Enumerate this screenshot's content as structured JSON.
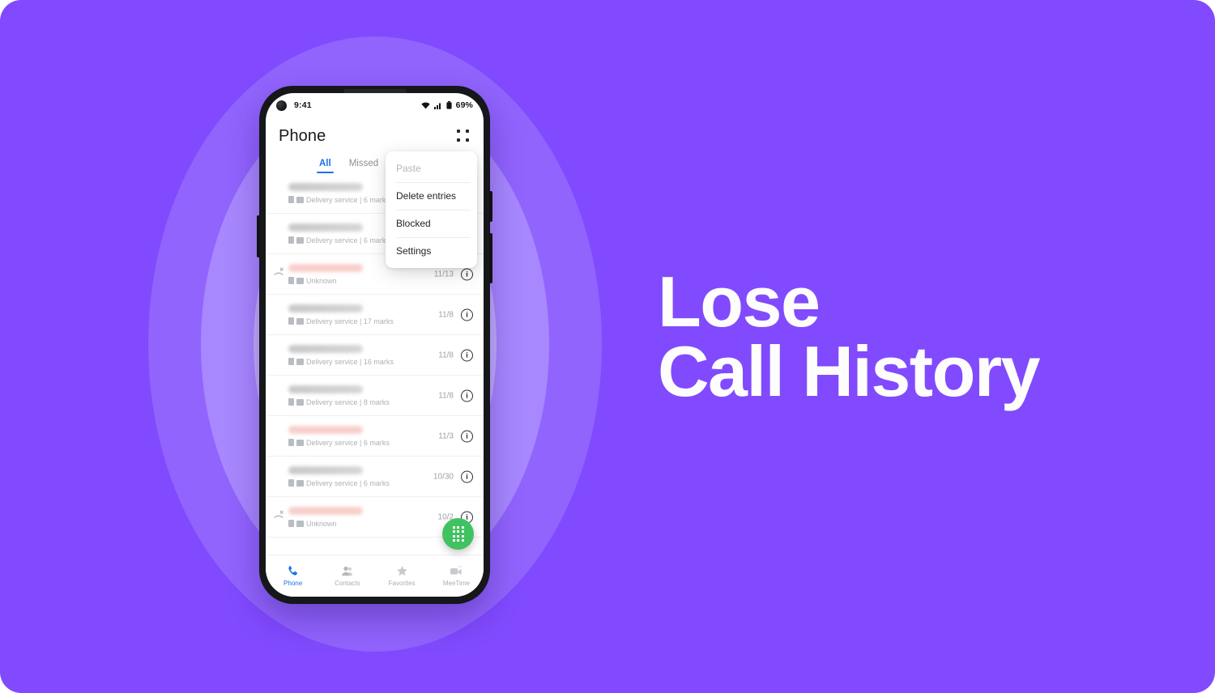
{
  "theme": {
    "bg_purple": "#814afe",
    "ring1": "#9164fd",
    "ring2": "#a888fe",
    "ring3": "#c3aefe",
    "accent_blue": "#1a73e8",
    "fab_green": "#3fc25f",
    "headline_color": "#fdfdfd"
  },
  "headline": {
    "line1": "Lose",
    "line2": "Call History"
  },
  "phone": {
    "status_bar": {
      "time": "9:41",
      "battery": "69%",
      "icons": [
        "wifi-icon",
        "cellular-signal-icon",
        "battery-icon"
      ]
    },
    "app_bar": {
      "title": "Phone",
      "overflow_icon": "grid-dots-icon"
    },
    "tabs": [
      {
        "label": "All",
        "active": true
      },
      {
        "label": "Missed",
        "active": false
      }
    ],
    "menu": {
      "items": [
        {
          "label": "Paste",
          "disabled": true
        },
        {
          "label": "Delete entries",
          "disabled": false
        },
        {
          "label": "Blocked",
          "disabled": false
        },
        {
          "label": "Settings",
          "disabled": false
        }
      ]
    },
    "calls": [
      {
        "name_redacted": true,
        "bar_color": "gray",
        "subtitle": "Delivery service | 6 marks",
        "date": "",
        "missed": false,
        "info": "i"
      },
      {
        "name_redacted": true,
        "bar_color": "gray",
        "subtitle": "Delivery service | 6 marks",
        "date": "",
        "missed": false,
        "info": "i"
      },
      {
        "name_redacted": true,
        "bar_color": "pink",
        "subtitle": "Unknown",
        "date": "11/13",
        "missed": true,
        "info": "i"
      },
      {
        "name_redacted": true,
        "bar_color": "gray",
        "subtitle": "Delivery service | 17 marks",
        "date": "11/8",
        "missed": false,
        "info": "i"
      },
      {
        "name_redacted": true,
        "bar_color": "gray",
        "subtitle": "Delivery service | 16 marks",
        "date": "11/8",
        "missed": false,
        "info": "i"
      },
      {
        "name_redacted": true,
        "bar_color": "gray",
        "subtitle": "Delivery service | 8 marks",
        "date": "11/8",
        "missed": false,
        "info": "i"
      },
      {
        "name_redacted": true,
        "bar_color": "pink",
        "subtitle": "Delivery service | 6 marks",
        "date": "11/3",
        "missed": false,
        "info": "i"
      },
      {
        "name_redacted": true,
        "bar_color": "gray",
        "subtitle": "Delivery service | 6 marks",
        "date": "10/30",
        "missed": false,
        "info": "i"
      },
      {
        "name_redacted": true,
        "bar_color": "pink",
        "subtitle": "Unknown",
        "date": "10/2",
        "missed": true,
        "info": "i"
      }
    ],
    "fab": {
      "icon": "dialpad-icon"
    },
    "bottom_nav": [
      {
        "label": "Phone",
        "icon": "phone-icon",
        "active": true
      },
      {
        "label": "Contacts",
        "icon": "contacts-icon",
        "active": false
      },
      {
        "label": "Favorites",
        "icon": "star-icon",
        "active": false
      },
      {
        "label": "MeeTime",
        "icon": "video-call-icon",
        "active": false
      }
    ]
  }
}
